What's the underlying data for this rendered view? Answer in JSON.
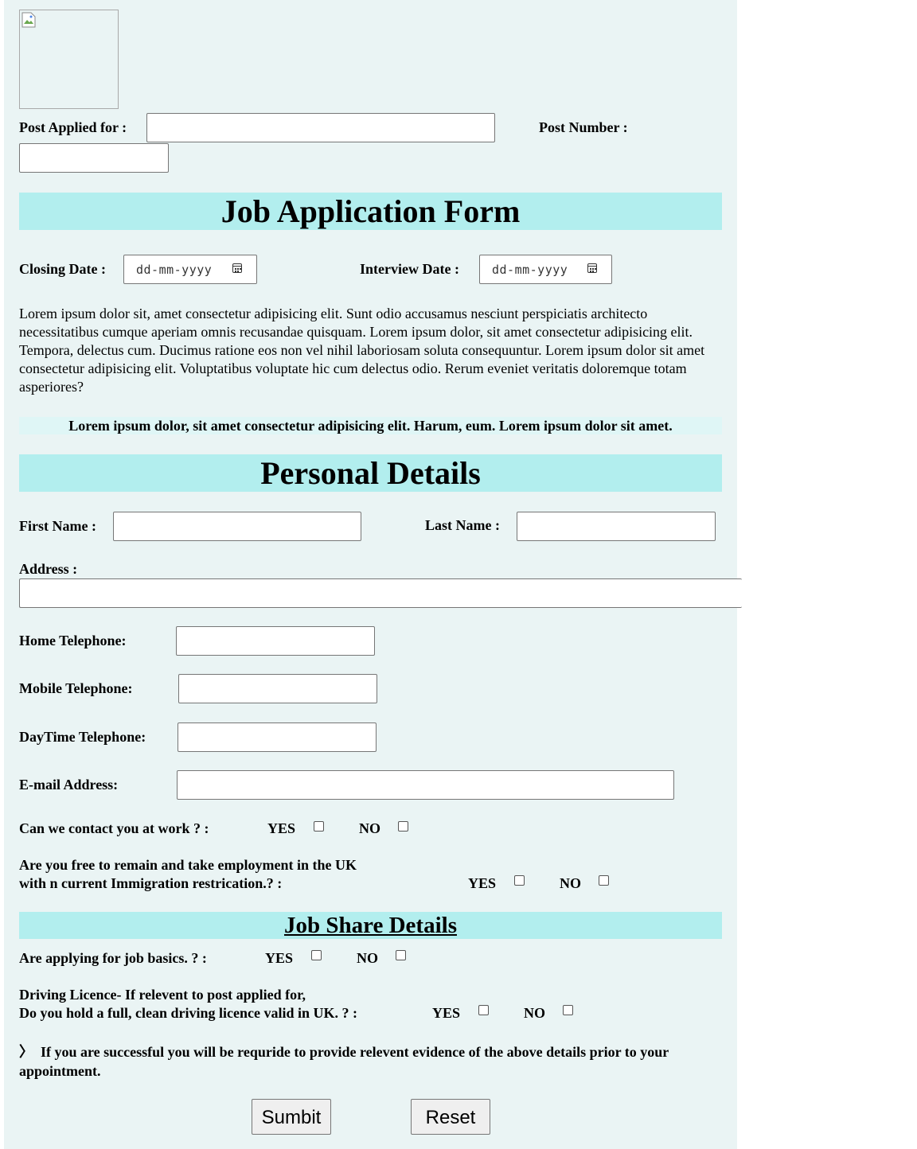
{
  "header": {
    "logo_icon": "broken-image-icon",
    "post_applied_label": "Post Applied for :",
    "post_number_label": "Post Number :"
  },
  "form_title": "Job Application Form",
  "dates": {
    "closing_label": "Closing Date :",
    "closing_placeholder": "dd-mm-yyyy",
    "interview_label": "Interview Date :",
    "interview_placeholder": "dd-mm-yyyy"
  },
  "intro_paragraph": "Lorem ipsum dolor sit, amet consectetur adipisicing elit. Sunt odio accusamus nesciunt perspiciatis architecto necessitatibus cumque aperiam omnis recusandae quisquam. Lorem ipsum dolor, sit amet consectetur adipisicing elit. Tempora, delectus cum. Ducimus ratione eos non vel nihil laboriosam soluta consequuntur. Lorem ipsum dolor sit amet consectetur adipisicing elit. Voluptatibus voluptate hic cum delectus odio. Rerum eveniet veritatis doloremque totam asperiores?",
  "notice": "Lorem ipsum dolor, sit amet consectetur adipisicing elit. Harum, eum. Lorem ipsum dolor sit amet.",
  "personal": {
    "title": "Personal Details",
    "first_name_label": "First Name :",
    "last_name_label": "Last Name :",
    "address_label": "Address :",
    "home_tel_label": "Home Telephone:",
    "mobile_tel_label": "Mobile Telephone:",
    "daytime_tel_label": "DayTime Telephone:",
    "email_label": "E-mail Address:",
    "contact_work_q": "Can we contact you at work ? :",
    "uk_q_line1": "Are you free to remain and take employment in the UK",
    "uk_q_line2": "with n current Immigration restrication.? :"
  },
  "jobshare": {
    "title": "Job Share Details",
    "basics_q": "Are applying for job basics. ? :",
    "licence_q_line1": "Driving Licence- If relevent to post applied for,",
    "licence_q_line2": "Do you hold a full, clean driving licence valid in UK. ? :"
  },
  "options": {
    "yes": "YES",
    "no": "NO"
  },
  "footer_note_icon": "angle-right-icon",
  "footer_note_bullet": "〉",
  "footer_note": "If you are successful you will be requride to provide relevent evidence of the above details prior to your appointment.",
  "buttons": {
    "submit": "Sumbit",
    "reset": "Reset"
  }
}
